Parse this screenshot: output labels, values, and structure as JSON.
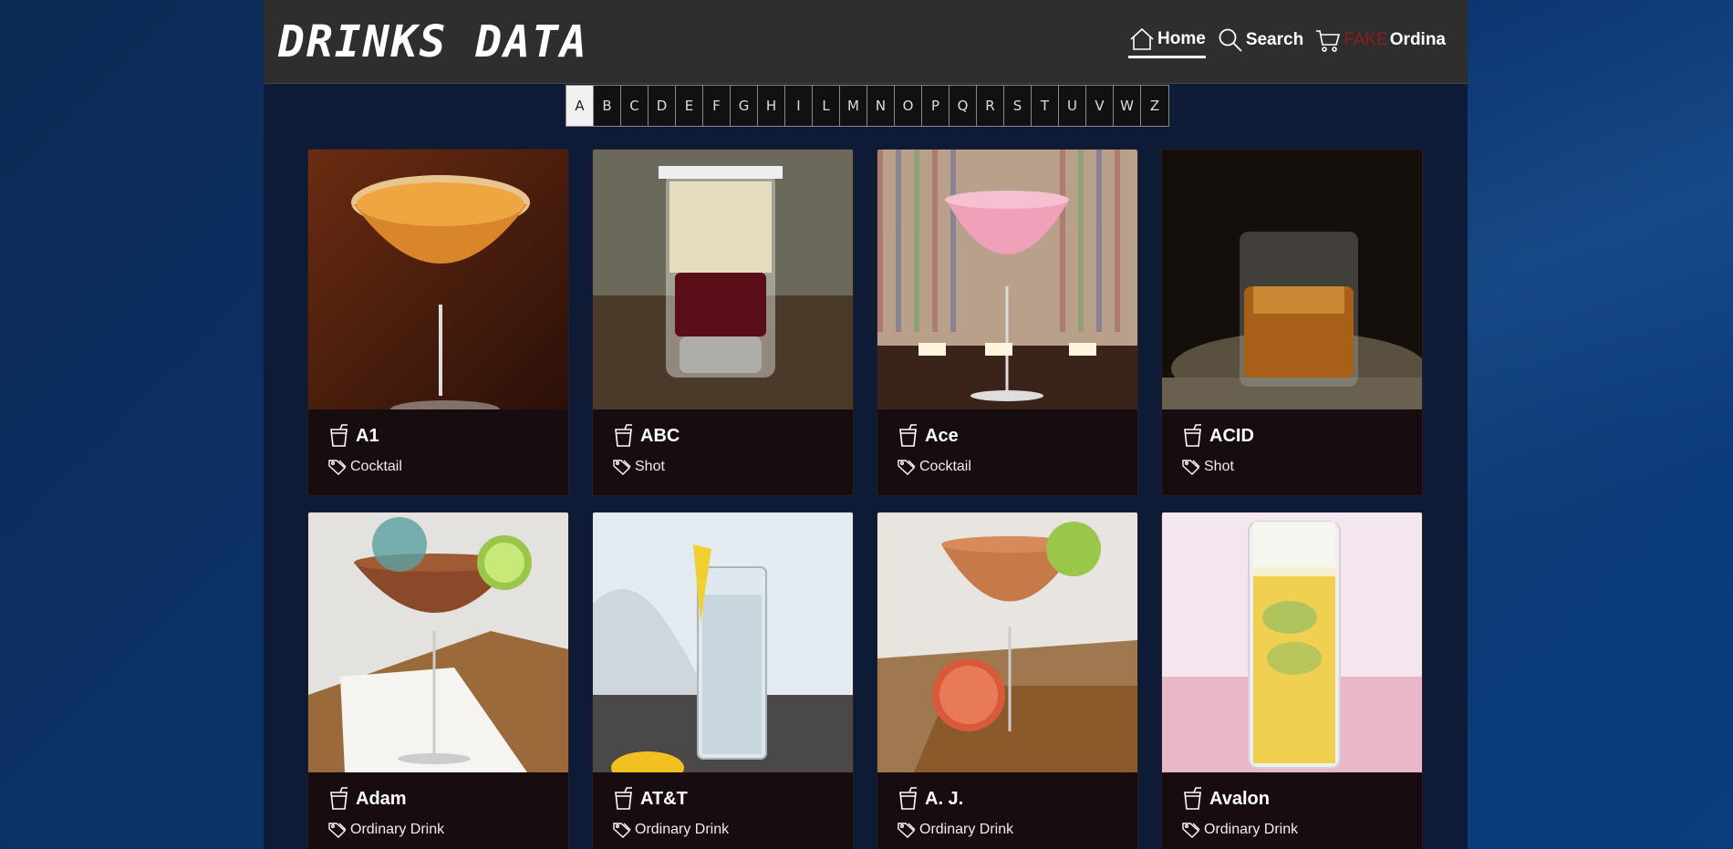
{
  "header": {
    "logo": "DRINKS DATA",
    "nav": {
      "home": "Home",
      "search": "Search",
      "cart_fake": "FAKE",
      "cart_label": "Ordina"
    }
  },
  "alphabet": {
    "active": "A",
    "letters": [
      "A",
      "B",
      "C",
      "D",
      "E",
      "F",
      "G",
      "H",
      "I",
      "L",
      "M",
      "N",
      "O",
      "P",
      "Q",
      "R",
      "S",
      "T",
      "U",
      "V",
      "W",
      "Z"
    ]
  },
  "drinks": [
    {
      "name": "A1",
      "category": "Cocktail"
    },
    {
      "name": "ABC",
      "category": "Shot"
    },
    {
      "name": "Ace",
      "category": "Cocktail"
    },
    {
      "name": "ACID",
      "category": "Shot"
    },
    {
      "name": "Adam",
      "category": "Ordinary Drink"
    },
    {
      "name": "AT&T",
      "category": "Ordinary Drink"
    },
    {
      "name": "A. J.",
      "category": "Ordinary Drink"
    },
    {
      "name": "Avalon",
      "category": "Ordinary Drink"
    }
  ],
  "colors": {
    "background": "#0b3670",
    "page": "#0d1b36",
    "header": "#2e2e2e",
    "card": "#170c10",
    "fake_text": "#8a1f1f"
  }
}
